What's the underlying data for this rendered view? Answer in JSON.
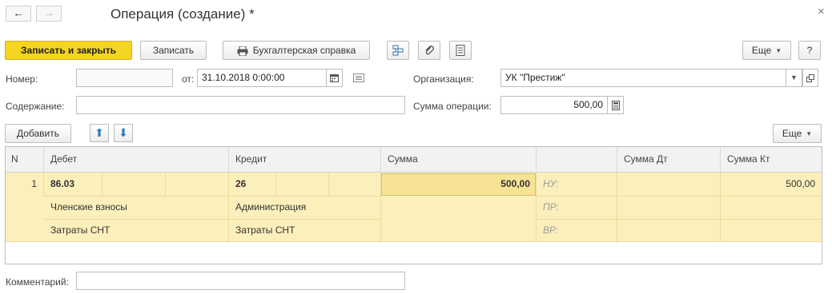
{
  "window": {
    "title": "Операция (создание) *",
    "close_glyph": "×",
    "back_glyph": "←",
    "forward_glyph": "→"
  },
  "toolbar": {
    "save_close": "Записать и закрыть",
    "save": "Записать",
    "report": "Бухгалтерская справка",
    "more": "Еще",
    "help": "?"
  },
  "form": {
    "number_label": "Номер:",
    "number_value": "",
    "date_label": "от:",
    "date_value": "31.10.2018  0:00:00",
    "org_label": "Организация:",
    "org_value": "УК \"Престиж\"",
    "content_label": "Содержание:",
    "content_value": "",
    "amount_label": "Сумма операции:",
    "amount_value": "500,00",
    "comment_label": "Комментарий:",
    "comment_value": ""
  },
  "table_toolbar": {
    "add": "Добавить",
    "more": "Еще"
  },
  "table": {
    "headers": {
      "n": "N",
      "debit": "Дебет",
      "credit": "Кредит",
      "sum": "Сумма",
      "blank": "",
      "sum_dt": "Сумма Дт",
      "sum_kt": "Сумма Кт"
    },
    "row": {
      "n": "1",
      "debit_account": "86.03",
      "debit_sub1": "Членские взносы",
      "debit_sub2": "Затраты СНТ",
      "credit_account": "26",
      "credit_sub1": "Администрация",
      "credit_sub2": "Затраты СНТ",
      "sum": "500,00",
      "label_nu": "НУ:",
      "label_pr": "ПР:",
      "label_vr": "ВР:",
      "sum_dt": "",
      "sum_kt": "500,00"
    }
  },
  "colors": {
    "primary_button": "#f5d422",
    "row_highlight": "#fbefbb",
    "selected_cell": "#f7e394",
    "arrow_blue": "#2e7ac4"
  }
}
